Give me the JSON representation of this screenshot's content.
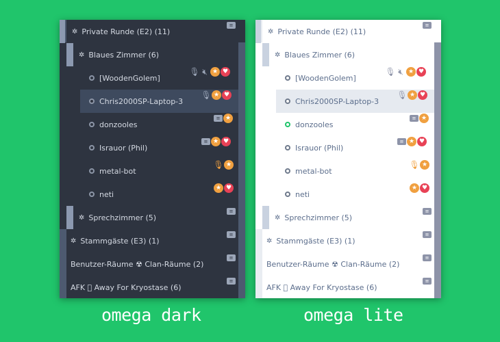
{
  "themes": [
    {
      "caption": "omega dark",
      "rows": [
        {
          "label": "Private Runde (E2) (11)",
          "icon": "✲"
        },
        {
          "label": "Blaues Zimmer (6)",
          "icon": "✲"
        },
        {
          "label": "[WoodenGolem]"
        },
        {
          "label": "Chris2000SP-Laptop-3"
        },
        {
          "label": "donzooles"
        },
        {
          "label": "Israuor (Phil)"
        },
        {
          "label": "metal-bot"
        },
        {
          "label": "neti"
        },
        {
          "label": "Sprechzimmer (5)",
          "icon": "✲"
        },
        {
          "label": "Stammgäste (E3) (1)",
          "icon": "✲"
        },
        {
          "label": "Benutzer-Räume ☢ Clan-Räume (2)"
        },
        {
          "label": "AFK ⃣ Away For Kryostase (6)"
        }
      ]
    },
    {
      "caption": "omega lite",
      "rows": [
        {
          "label": "Private Runde (E2) (11)",
          "icon": "✲"
        },
        {
          "label": "Blaues Zimmer (6)",
          "icon": "✲"
        },
        {
          "label": "[WoodenGolem]"
        },
        {
          "label": "Chris2000SP-Laptop-3"
        },
        {
          "label": "donzooles"
        },
        {
          "label": "Israuor (Phil)"
        },
        {
          "label": "metal-bot"
        },
        {
          "label": "neti"
        },
        {
          "label": "Sprechzimmer (5)",
          "icon": "✲"
        },
        {
          "label": "Stammgäste (E3) (1)",
          "icon": "✲"
        },
        {
          "label": "Benutzer-Räume ☢ Clan-Räume (2)"
        },
        {
          "label": "AFK ⃣ Away For Kryostase (6)"
        }
      ]
    }
  ],
  "icons": {
    "chat": "chat-icon",
    "star": "★",
    "heart": "♥",
    "mic_muted": "mic-muted-icon",
    "speaker_muted": "speaker-muted-icon"
  },
  "colors": {
    "background": "#20c56b",
    "dark_panel": "#2e3440",
    "lite_panel": "#ffffff",
    "star": "#f0a040",
    "heart": "#e84256",
    "online_dot": "#20c56b"
  }
}
